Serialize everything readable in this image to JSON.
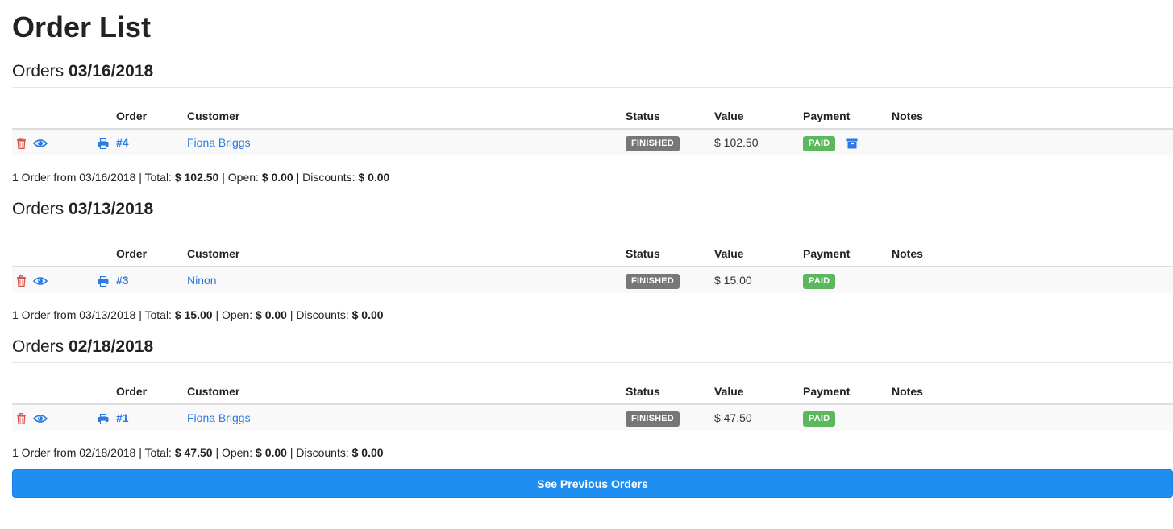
{
  "page_title": "Order List",
  "colors": {
    "link": "#2a7ae2",
    "danger": "#d9534f",
    "status_finished": "#777777",
    "payment_paid": "#5cb85c",
    "primary_button": "#1e8ef0"
  },
  "table_headers": {
    "order": "Order",
    "customer": "Customer",
    "status": "Status",
    "value": "Value",
    "payment": "Payment",
    "notes": "Notes"
  },
  "groups": [
    {
      "heading_prefix": "Orders",
      "date": "03/16/2018",
      "rows": [
        {
          "order": "#4",
          "customer": "Fiona Briggs",
          "status": "FINISHED",
          "value": "$ 102.50",
          "payment": "PAID",
          "has_archive_icon": true,
          "notes": ""
        }
      ],
      "summary": {
        "count_text": "1 Order from 03/16/2018",
        "total_label": "Total:",
        "total": "$ 102.50",
        "open_label": "Open:",
        "open": "$ 0.00",
        "discounts_label": "Discounts:",
        "discounts": "$ 0.00"
      }
    },
    {
      "heading_prefix": "Orders",
      "date": "03/13/2018",
      "rows": [
        {
          "order": "#3",
          "customer": "Ninon",
          "status": "FINISHED",
          "value": "$ 15.00",
          "payment": "PAID",
          "has_archive_icon": false,
          "notes": ""
        }
      ],
      "summary": {
        "count_text": "1 Order from 03/13/2018",
        "total_label": "Total:",
        "total": "$ 15.00",
        "open_label": "Open:",
        "open": "$ 0.00",
        "discounts_label": "Discounts:",
        "discounts": "$ 0.00"
      }
    },
    {
      "heading_prefix": "Orders",
      "date": "02/18/2018",
      "rows": [
        {
          "order": "#1",
          "customer": "Fiona Briggs",
          "status": "FINISHED",
          "value": "$ 47.50",
          "payment": "PAID",
          "has_archive_icon": false,
          "notes": ""
        }
      ],
      "summary": {
        "count_text": "1 Order from 02/18/2018",
        "total_label": "Total:",
        "total": "$ 47.50",
        "open_label": "Open:",
        "open": "$ 0.00",
        "discounts_label": "Discounts:",
        "discounts": "$ 0.00"
      }
    }
  ],
  "see_previous_label": "See Previous Orders"
}
